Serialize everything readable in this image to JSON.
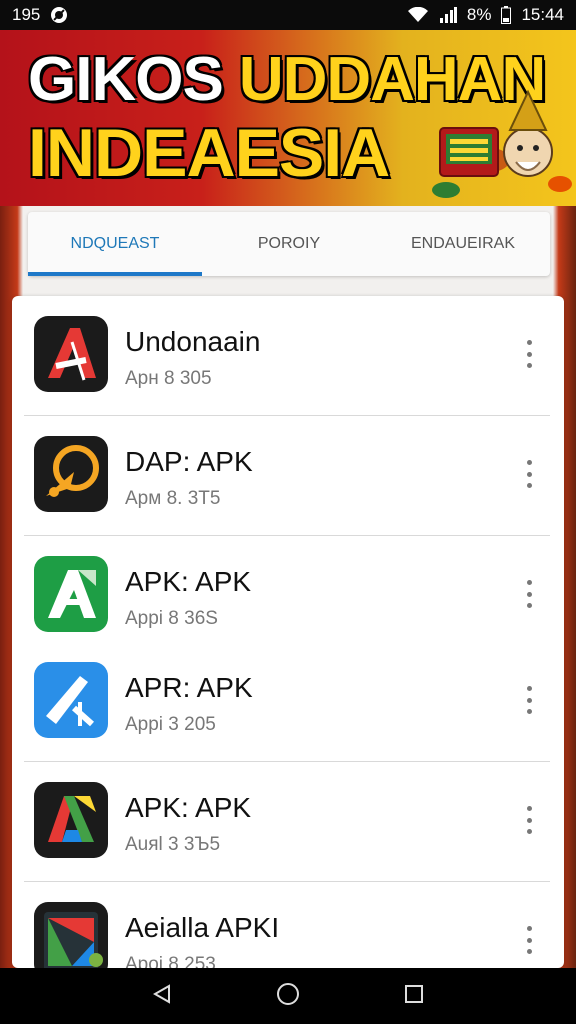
{
  "status_bar": {
    "left_text": "195",
    "battery_text": "8%",
    "time": "15:44",
    "icons": [
      "settings-badge-icon",
      "wifi-icon",
      "signal-icon",
      "battery-icon"
    ]
  },
  "banner": {
    "word1": "GIKOS",
    "word2": "UDDAHAN",
    "line2": "INDEAESIA"
  },
  "tabs": [
    {
      "label": "NDQUEAST",
      "active": true
    },
    {
      "label": "POROIY",
      "active": false
    },
    {
      "label": "ENDAUEIRAK",
      "active": false
    }
  ],
  "apps": [
    {
      "name": "Undonaain",
      "meta": "Apн 8 305",
      "icon": "red-a-app-icon"
    },
    {
      "name": "DAP: APK",
      "meta": "Apм 8. 3Т5",
      "icon": "orange-ring-app-icon"
    },
    {
      "name": "APK: APK",
      "meta": "Appi 8 36S",
      "icon": "green-a-app-icon"
    },
    {
      "name": "APR: APK",
      "meta": "Appi 3 205",
      "icon": "blue-a-app-icon"
    },
    {
      "name": "APK: APK",
      "meta": "Auяl 3 3Ъ5",
      "icon": "multicolor-a-app-icon"
    },
    {
      "name": "Aeialla APKI",
      "meta": "Apoi 8 253",
      "icon": "tablet-app-icon"
    }
  ],
  "colors": {
    "tab_accent": "#1e78c8",
    "banner_red": "#c8201a",
    "banner_yellow": "#ffd21c"
  }
}
